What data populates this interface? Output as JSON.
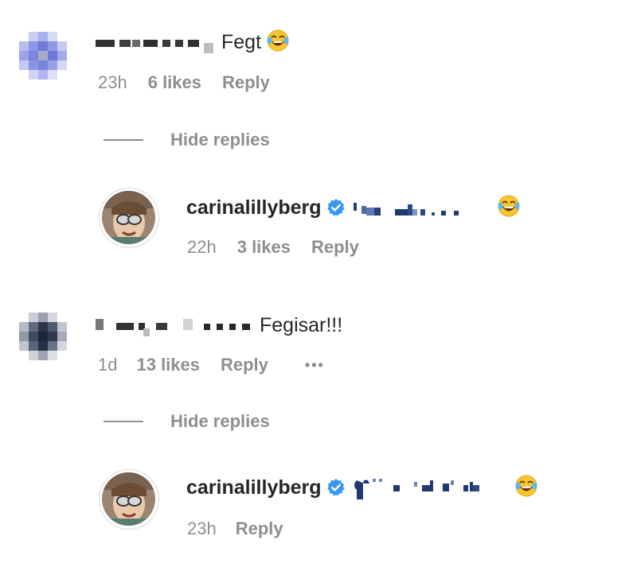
{
  "comments": [
    {
      "text": "Fegt",
      "time": "23h",
      "likes": "6 likes",
      "reply_label": "Reply",
      "hide_replies_label": "Hide replies",
      "replies": [
        {
          "username": "carinalillyberg",
          "verified": true,
          "time": "22h",
          "likes": "3 likes",
          "reply_label": "Reply"
        }
      ]
    },
    {
      "text": "Fegisar!!!",
      "time": "1d",
      "likes": "13 likes",
      "reply_label": "Reply",
      "more_label": "•••",
      "hide_replies_label": "Hide replies",
      "replies": [
        {
          "username": "carinalillyberg",
          "verified": true,
          "time": "23h",
          "reply_label": "Reply"
        }
      ]
    }
  ],
  "icons": {
    "verified": "verified-badge-icon",
    "emoji": "face-with-tears-of-joy"
  },
  "colors": {
    "text": "#262626",
    "secondary": "#8e8e8e",
    "verified": "#3897f0",
    "emoji_yellow": "#f9c531"
  }
}
